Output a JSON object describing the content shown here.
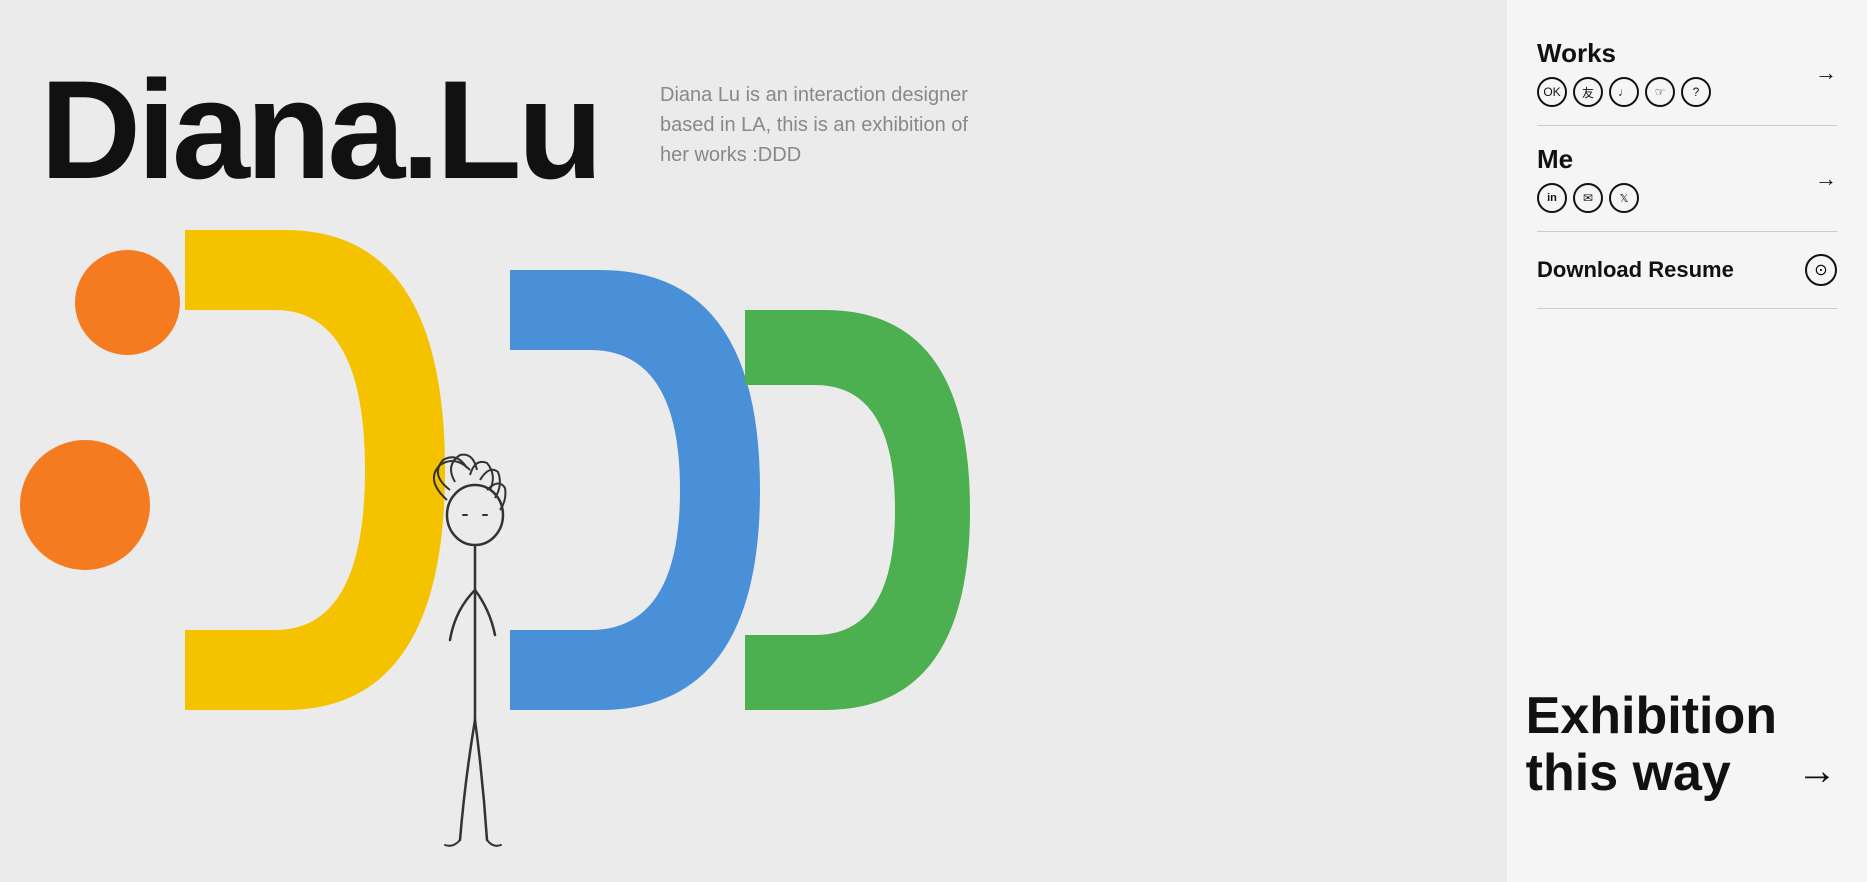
{
  "site": {
    "title": "Diana.Lu",
    "description": "Diana Lu is an interaction designer based in LA, this is an exhibition of her works :DDD"
  },
  "sidebar": {
    "works": {
      "label": "Works",
      "icons": [
        "OK",
        "友",
        "♫",
        "☞",
        "?"
      ]
    },
    "me": {
      "label": "Me",
      "icons": [
        "in",
        "✉",
        "𝕏"
      ]
    },
    "download": {
      "label": "Download Resume"
    },
    "exhibition": {
      "line1": "Exhibition",
      "line2": "this way"
    }
  },
  "colors": {
    "orange": "#F47B20",
    "yellow": "#F5C200",
    "blue": "#4A90D9",
    "green": "#4CAF50",
    "background": "#EBEBEB",
    "sidebar_bg": "#F5F5F5",
    "text": "#111111",
    "muted": "#888888"
  }
}
